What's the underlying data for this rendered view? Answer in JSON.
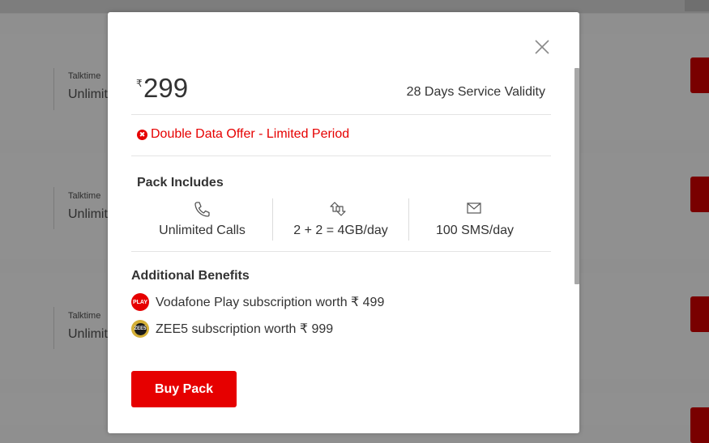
{
  "background": {
    "cards": [
      {
        "label": "Talktime",
        "value": "Unlimited"
      },
      {
        "label": "Talktime",
        "value": "Unlimited"
      },
      {
        "label": "Talktime",
        "value": "Unlimited"
      }
    ]
  },
  "modal": {
    "price": {
      "currency": "₹",
      "amount": "299"
    },
    "validity": "28 Days Service Validity",
    "offer": "Double Data Offer - Limited Period",
    "pack_includes": {
      "title": "Pack Includes",
      "items": [
        {
          "icon": "phone-icon",
          "label": "Unlimited Calls"
        },
        {
          "icon": "data-arrows-icon",
          "label": "2 + 2 = 4GB/day"
        },
        {
          "icon": "envelope-icon",
          "label": "100 SMS/day"
        }
      ]
    },
    "additional_benefits": {
      "title": "Additional Benefits",
      "items": [
        {
          "icon": "vodafone-play-logo",
          "logo_text": "PLAY",
          "label": "Vodafone Play subscription worth ₹ 499"
        },
        {
          "icon": "zee5-logo",
          "logo_text": "ZEE5",
          "label": "ZEE5 subscription worth ₹ 999"
        }
      ]
    },
    "buy_button": "Buy Pack"
  },
  "colors": {
    "accent": "#e60000",
    "text": "#333333",
    "overlay": "#8f8f8f"
  }
}
